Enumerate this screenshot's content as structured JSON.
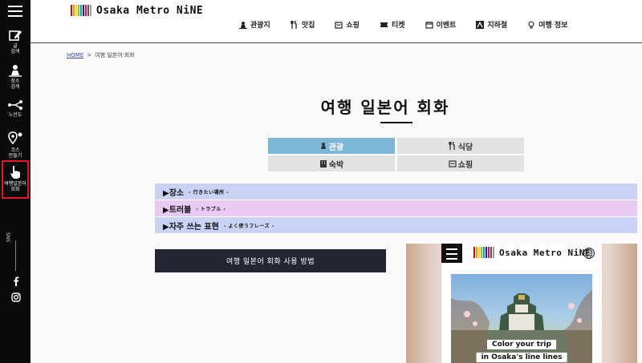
{
  "sidebar": {
    "items": [
      {
        "label": "글\n검색",
        "icon": "pencil-icon"
      },
      {
        "label": "장소\n검색",
        "icon": "map-person-icon"
      },
      {
        "label": "노선도",
        "icon": "route-icon"
      },
      {
        "label": "코스\n만들기",
        "icon": "course-pin-icon"
      },
      {
        "label": "여행일본어\n회화",
        "icon": "pointer-hand-icon"
      }
    ],
    "sns_label": "SNS"
  },
  "header": {
    "logo_text": "Osaka Metro NiNE",
    "logo_colors": [
      "#e60012",
      "#f39800",
      "#ffd900",
      "#8fc31f",
      "#00a0e9",
      "#1d2088",
      "#e4007f",
      "#7d4e24",
      "#9e9e9f"
    ],
    "nav": [
      {
        "label": "관광지",
        "icon": "sightseeing-icon"
      },
      {
        "label": "맛집",
        "icon": "restaurant-icon"
      },
      {
        "label": "쇼핑",
        "icon": "shopping-bag-icon"
      },
      {
        "label": "티켓",
        "icon": "ticket-icon"
      },
      {
        "label": "이벤트",
        "icon": "calendar-icon"
      },
      {
        "label": "지하철",
        "icon": "subway-icon"
      },
      {
        "label": "여행 정보",
        "icon": "lightbulb-icon"
      }
    ]
  },
  "breadcrumb": {
    "home": "HOME",
    "separator": ">",
    "current": "여행 일본어 회화"
  },
  "page": {
    "title": "여행 일본어 회화"
  },
  "categories": [
    {
      "label": "관광",
      "active": true,
      "icon": "sightseeing-icon"
    },
    {
      "label": "식당",
      "active": false,
      "icon": "restaurant-icon"
    },
    {
      "label": "숙박",
      "active": false,
      "icon": "hotel-icon"
    },
    {
      "label": "쇼핑",
      "active": false,
      "icon": "shopping-bag-icon"
    }
  ],
  "accordions": [
    {
      "title": "▶장소",
      "sub": "- 行きたい場所 -",
      "color": "#c9d3f5"
    },
    {
      "title": "▶트러블",
      "sub": "- トラブル -",
      "color": "#e7c9f2"
    },
    {
      "title": "▶자주 쓰는 표현",
      "sub": "- よく使うフレーズ -",
      "color": "#c9d3f5"
    }
  ],
  "howto_button": "여행 일본어 회화 사용 방법",
  "preview": {
    "logo_text": "Osaka Metro NiNE",
    "caption1": "Color your trip",
    "caption2": "in Osaka's line lines"
  }
}
